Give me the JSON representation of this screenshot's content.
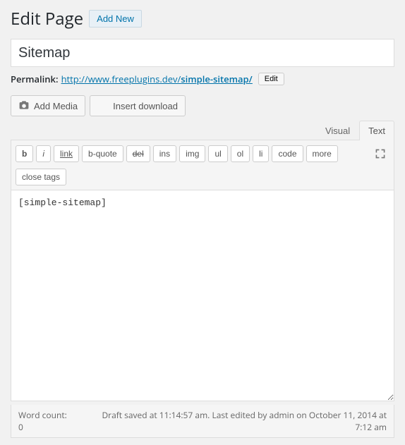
{
  "heading": "Edit Page",
  "add_new": "Add New",
  "title_value": "Sitemap",
  "permalink": {
    "label": "Permalink:",
    "base": "http://www.freeplugins.dev/",
    "slug": "simple-sitemap/",
    "edit": "Edit"
  },
  "buttons": {
    "add_media": "Add Media",
    "insert_download": "Insert download"
  },
  "tabs": {
    "visual": "Visual",
    "text": "Text"
  },
  "quicktags": {
    "b": "b",
    "i": "i",
    "link": "link",
    "bquote": "b-quote",
    "del": "del",
    "ins": "ins",
    "img": "img",
    "ul": "ul",
    "ol": "ol",
    "li": "li",
    "code": "code",
    "more": "more",
    "close": "close tags"
  },
  "content": "[simple-sitemap]",
  "status": {
    "word_count_label": "Word count:",
    "word_count": "0",
    "message": "Draft saved at 11:14:57 am. Last edited by admin on October 11, 2014 at 7:12 am"
  }
}
